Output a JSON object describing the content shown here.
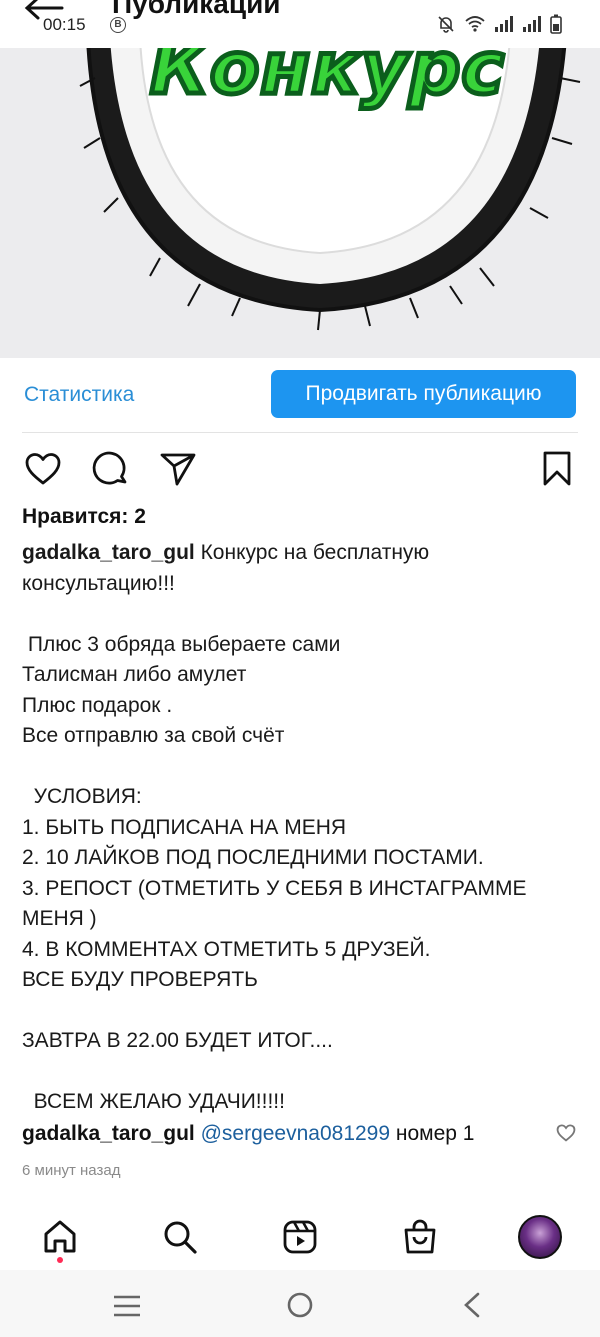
{
  "status_bar": {
    "time": "00:15",
    "badge": "B"
  },
  "header": {
    "title": "Публикации"
  },
  "post_image": {
    "text": "Конкурс"
  },
  "actions": {
    "statistics": "Статистика",
    "promote": "Продвигать публикацию"
  },
  "likes": "Нравится: 2",
  "caption": {
    "username": "gadalka_taro_gul",
    "text": " Конкурс на бесплатную\nконсультацию!!!\n\n Плюс 3 обряда выбераете сами\nТалисман либо амулет\nПлюс подарок .\nВсе отправлю за свой счёт\n\n  УСЛОВИЯ:\n1. БЫТЬ ПОДПИСАНА НА МЕНЯ\n2. 10 ЛАЙКОВ ПОД ПОСЛЕДНИМИ ПОСТАМИ.\n3. РЕПОСТ (ОТМЕТИТЬ У СЕБЯ В ИНСТАГРАММЕ\nМЕНЯ )\n4. В КОММЕНТАХ ОТМЕТИТЬ 5 ДРУЗЕЙ.\nВСЕ БУДУ ПРОВЕРЯТЬ\n\nЗАВТРА В 22.00 БУДЕТ ИТОГ....\n\n  ВСЕМ ЖЕЛАЮ УДАЧИ!!!!!"
  },
  "comment": {
    "username": "gadalka_taro_gul",
    "mention": "@sergeevna081299",
    "text": " номер 1"
  },
  "time_ago": "6 минут назад",
  "colors": {
    "accent": "#1d95f0",
    "link": "#2a8ed6",
    "mention": "#1c5f9d",
    "notification_dot": "#ff2b55",
    "neon_text": "#39d33a"
  }
}
